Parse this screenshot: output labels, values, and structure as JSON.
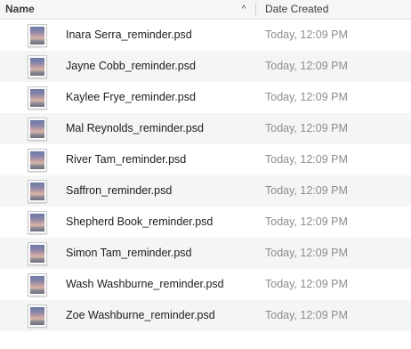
{
  "columns": {
    "name": "Name",
    "date_created": "Date Created",
    "sort_indicator": "^",
    "sort_icon": "chevron-up-icon"
  },
  "files": [
    {
      "name": "Inara Serra_reminder.psd",
      "date": "Today, 12:09 PM",
      "icon": "psd-file-icon"
    },
    {
      "name": "Jayne Cobb_reminder.psd",
      "date": "Today, 12:09 PM",
      "icon": "psd-file-icon"
    },
    {
      "name": "Kaylee Frye_reminder.psd",
      "date": "Today, 12:09 PM",
      "icon": "psd-file-icon"
    },
    {
      "name": "Mal Reynolds_reminder.psd",
      "date": "Today, 12:09 PM",
      "icon": "psd-file-icon"
    },
    {
      "name": "River Tam_reminder.psd",
      "date": "Today, 12:09 PM",
      "icon": "psd-file-icon"
    },
    {
      "name": "Saffron_reminder.psd",
      "date": "Today, 12:09 PM",
      "icon": "psd-file-icon"
    },
    {
      "name": "Shepherd Book_reminder.psd",
      "date": "Today, 12:09 PM",
      "icon": "psd-file-icon"
    },
    {
      "name": "Simon Tam_reminder.psd",
      "date": "Today, 12:09 PM",
      "icon": "psd-file-icon"
    },
    {
      "name": "Wash Washburne_reminder.psd",
      "date": "Today, 12:09 PM",
      "icon": "psd-file-icon"
    },
    {
      "name": "Zoe Washburne_reminder.psd",
      "date": "Today, 12:09 PM",
      "icon": "psd-file-icon"
    }
  ],
  "colors": {
    "header_bg": "#f6f6f6",
    "row_alt_bg": "#f4f5f5",
    "name_text": "#1c1c1c",
    "date_text": "#8d8d8d"
  }
}
